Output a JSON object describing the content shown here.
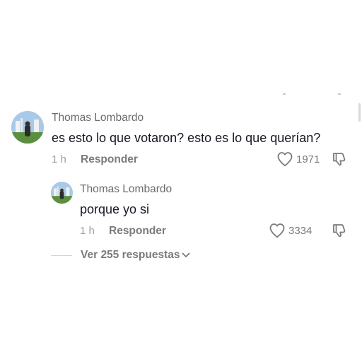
{
  "comments": [
    {
      "username": "Thomas Lombardo",
      "text": "es esto lo que votaron? esto es lo que querían?",
      "time": "1 h",
      "reply_label": "Responder",
      "likes": "1971"
    },
    {
      "username": "Thomas Lombardo",
      "text": "porque yo si",
      "time": "1 h",
      "reply_label": "Responder",
      "likes": "3334"
    }
  ],
  "view_replies": {
    "label": "Ver 255 respuestas"
  },
  "icons": {
    "heart": "heart-outline-icon",
    "dislike": "thumbs-down-outline-icon",
    "chevron": "chevron-down-icon"
  },
  "colors": {
    "text": "#161823",
    "secondary": "#7a7a7a",
    "username": "#6b6b6b",
    "time": "#a0a0a0"
  }
}
